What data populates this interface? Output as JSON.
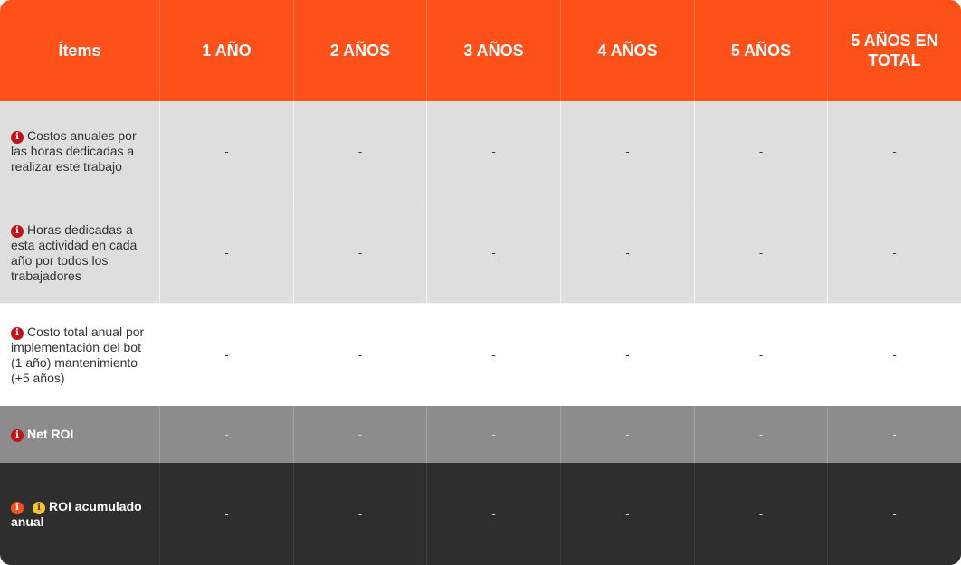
{
  "colors": {
    "header_bg": "#fe5019",
    "light_row_bg": "#dedede",
    "white_row_bg": "#ffffff",
    "grey_row_bg": "#8c8c8c",
    "dark_row_bg": "#2e2e2e",
    "info_icon_red": "#c0141b",
    "info_icon_orange": "#fe5019",
    "info_icon_yellow": "#f2c230"
  },
  "header": {
    "items": "Ítems",
    "year1": "1 AÑO",
    "year2": "2 AÑOS",
    "year3": "3 AÑOS",
    "year4": "4 AÑOS",
    "year5": "5 AÑOS",
    "total": "5 AÑOS EN TOTAL"
  },
  "info_glyph": "i",
  "rows": [
    {
      "label": "Costos anuales por las horas dedicadas a realizar este trabajo",
      "icons": [
        "info-icon"
      ],
      "values": [
        "-",
        "-",
        "-",
        "-",
        "-",
        "-"
      ]
    },
    {
      "label": "Horas dedicadas a esta actividad en cada año por todos los trabajadores",
      "icons": [
        "info-icon"
      ],
      "values": [
        "-",
        "-",
        "-",
        "-",
        "-",
        "-"
      ]
    },
    {
      "label": "Costo total anual por implementación del bot (1 año) mantenimiento (+5 años)",
      "icons": [
        "info-icon"
      ],
      "values": [
        "-",
        "-",
        "-",
        "-",
        "-",
        "-"
      ]
    },
    {
      "label": "Net ROI",
      "icons": [
        "info-icon"
      ],
      "values": [
        "-",
        "-",
        "-",
        "-",
        "-",
        "-"
      ]
    },
    {
      "label": "ROI acumulado anual",
      "icons": [
        "info-icon",
        "info-icon"
      ],
      "values": [
        "-",
        "-",
        "-",
        "-",
        "-",
        "-"
      ]
    }
  ]
}
